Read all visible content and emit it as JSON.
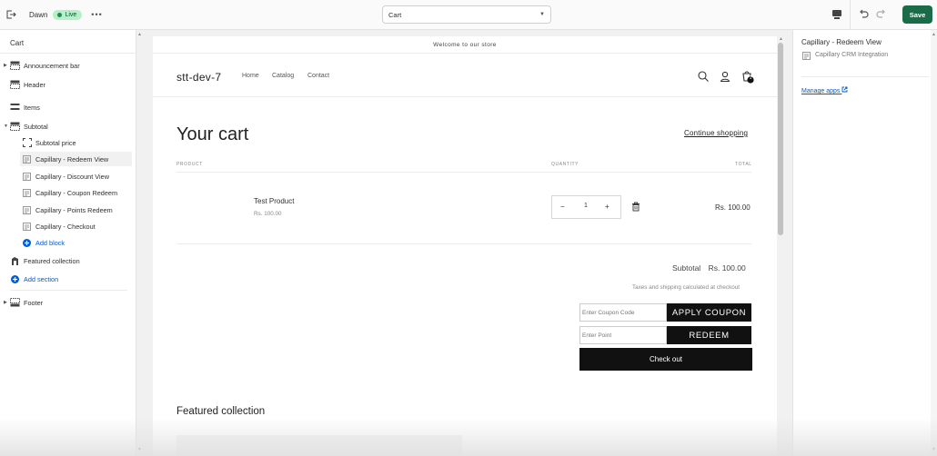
{
  "topbar": {
    "exit_icon": "exit-icon",
    "store_name": "Dawn",
    "live_badge": "Live",
    "more_label": "•••",
    "template_select": "Cart",
    "save_label": "Save"
  },
  "sidebar": {
    "title": "Cart",
    "items": [
      {
        "label": "Announcement bar",
        "icon": "section-icon",
        "level": 0,
        "expandable": true
      },
      {
        "label": "Header",
        "icon": "header-icon",
        "level": 0,
        "expandable": false
      },
      {
        "label": "Items",
        "icon": "list-icon",
        "level": 0,
        "expandable": false
      },
      {
        "label": "Subtotal",
        "icon": "section-icon",
        "level": 0,
        "expandable": true,
        "expanded": true
      },
      {
        "label": "Subtotal price",
        "icon": "block-icon",
        "level": 1
      },
      {
        "label": "Capillary - Redeem View",
        "icon": "app-block-icon",
        "level": 1,
        "selected": true
      },
      {
        "label": "Capillary - Discount View",
        "icon": "app-block-icon",
        "level": 1
      },
      {
        "label": "Capillary - Coupon Redeem",
        "icon": "app-block-icon",
        "level": 1
      },
      {
        "label": "Capillary - Points Redeem",
        "icon": "app-block-icon",
        "level": 1
      },
      {
        "label": "Capillary - Checkout",
        "icon": "app-block-icon",
        "level": 1
      },
      {
        "label": "Add block",
        "icon": "plus-circle-icon",
        "level": 1,
        "action": true
      },
      {
        "label": "Featured collection",
        "icon": "collection-icon",
        "level": 0
      },
      {
        "label": "Add section",
        "icon": "plus-circle-icon",
        "level": 0,
        "action": true
      },
      {
        "label": "Footer",
        "icon": "footer-icon",
        "level": 0,
        "expandable": true
      }
    ]
  },
  "preview": {
    "announcement": "Welcome to our store",
    "brand": "stt-dev-7",
    "nav": [
      "Home",
      "Catalog",
      "Contact"
    ],
    "cart_count": "1",
    "cart_title": "Your cart",
    "continue_shopping": "Continue shopping",
    "col_product": "PRODUCT",
    "col_quantity": "QUANTITY",
    "col_total": "TOTAL",
    "product_name": "Test Product",
    "product_price": "Rs. 100.00",
    "qty_minus": "−",
    "qty_value": "1",
    "qty_plus": "+",
    "line_total": "Rs. 100.00",
    "subtotal_label": "Subtotal",
    "subtotal_value": "Rs. 100.00",
    "taxes_note": "Taxes and shipping calculated at checkout",
    "coupon_placeholder": "Enter Coupon Code",
    "apply_coupon": "APPLY COUPON",
    "point_placeholder": "Enter Point",
    "redeem": "REDEEM",
    "checkout": "Check out",
    "featured_title": "Featured collection"
  },
  "right_panel": {
    "title": "Capillary - Redeem View",
    "subtitle": "Capillary CRM Integration",
    "manage_apps": "Manage apps"
  },
  "colors": {
    "save_bg": "#1a6b47",
    "live_bg": "#b4f0c8",
    "link_blue": "#005bd3",
    "button_black": "#111111"
  }
}
